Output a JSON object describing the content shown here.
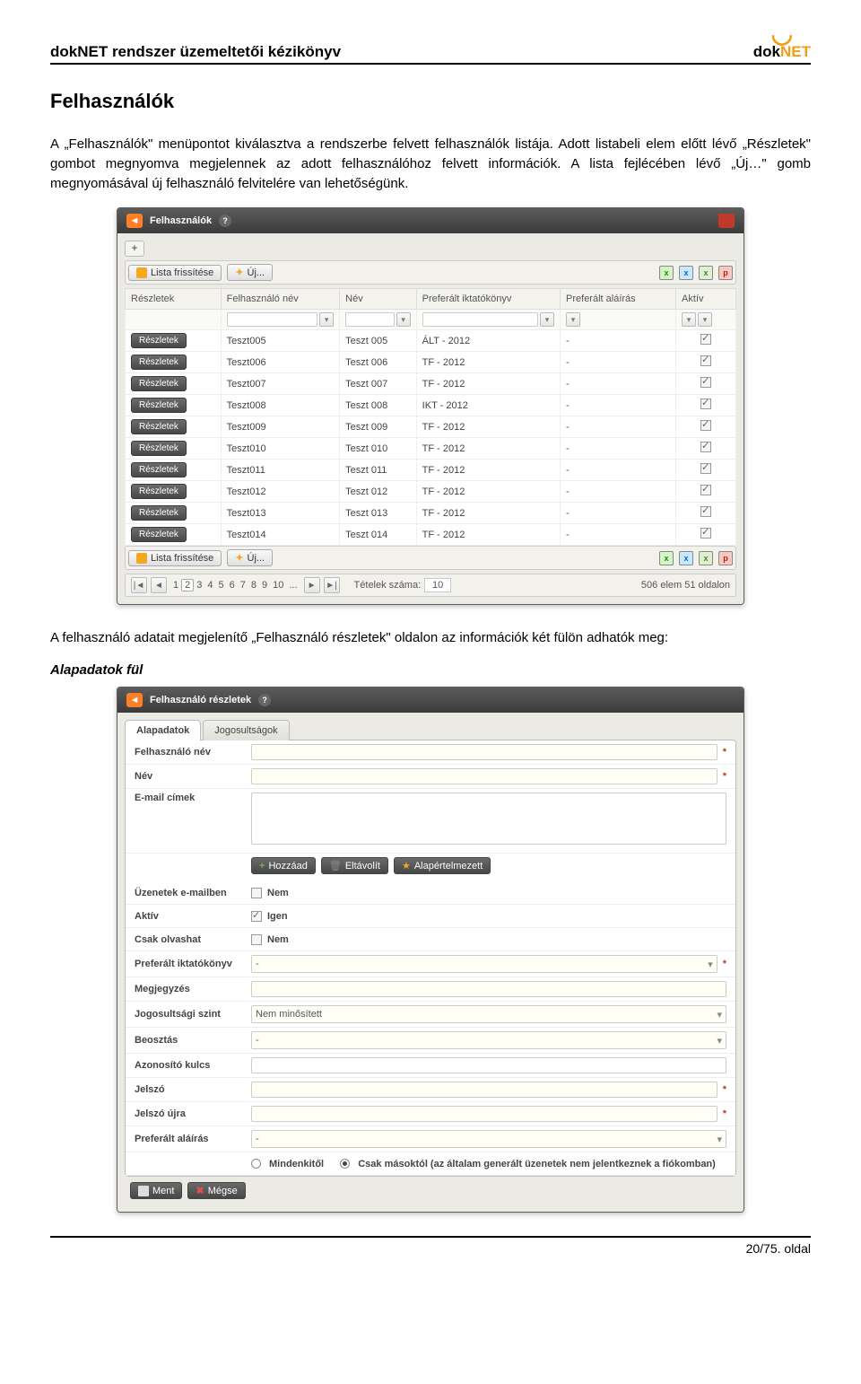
{
  "doc": {
    "header_title": "dokNET rendszer üzemeltetői kézikönyv",
    "logo_brand_left": "dok",
    "logo_brand_right": "NET",
    "section_title": "Felhasználók",
    "para1": "A „Felhasználók\" menüpontot kiválasztva a rendszerbe felvett felhasználók listája. Adott listabeli elem előtt lévő „Részletek\" gombot megnyomva megjelennek az adott felhasználóhoz felvett információk. A lista fejlécében lévő „Új…\" gomb megnyomásával új felhasználó felvitelére van lehetőségünk.",
    "para2": "A felhasználó adatait megjelenítő „Felhasználó részletek\" oldalon az információk két fülön adhatók meg:",
    "sub_alap": "Alapadatok fül",
    "page_number": "20/75. oldal"
  },
  "list": {
    "title": "Felhasználók",
    "refresh": "Lista frissítése",
    "new_btn": "Új...",
    "cols": {
      "details": "Részletek",
      "username": "Felhasználó név",
      "name": "Név",
      "book": "Preferált iktatókönyv",
      "sign": "Preferált aláírás",
      "active": "Aktív"
    },
    "rows": [
      {
        "btn": "Részletek",
        "u": "Teszt005",
        "n": "Teszt 005",
        "b": "ÁLT - 2012",
        "s": "-",
        "a": true
      },
      {
        "btn": "Részletek",
        "u": "Teszt006",
        "n": "Teszt 006",
        "b": "TF - 2012",
        "s": "-",
        "a": true
      },
      {
        "btn": "Részletek",
        "u": "Teszt007",
        "n": "Teszt 007",
        "b": "TF - 2012",
        "s": "-",
        "a": true
      },
      {
        "btn": "Részletek",
        "u": "Teszt008",
        "n": "Teszt 008",
        "b": "IKT - 2012",
        "s": "-",
        "a": true
      },
      {
        "btn": "Részletek",
        "u": "Teszt009",
        "n": "Teszt 009",
        "b": "TF - 2012",
        "s": "-",
        "a": true
      },
      {
        "btn": "Részletek",
        "u": "Teszt010",
        "n": "Teszt 010",
        "b": "TF - 2012",
        "s": "-",
        "a": true
      },
      {
        "btn": "Részletek",
        "u": "Teszt011",
        "n": "Teszt 011",
        "b": "TF - 2012",
        "s": "-",
        "a": true
      },
      {
        "btn": "Részletek",
        "u": "Teszt012",
        "n": "Teszt 012",
        "b": "TF - 2012",
        "s": "-",
        "a": true
      },
      {
        "btn": "Részletek",
        "u": "Teszt013",
        "n": "Teszt 013",
        "b": "TF - 2012",
        "s": "-",
        "a": true
      },
      {
        "btn": "Részletek",
        "u": "Teszt014",
        "n": "Teszt 014",
        "b": "TF - 2012",
        "s": "-",
        "a": true
      }
    ],
    "pager": {
      "pages": [
        "1",
        "2",
        "3",
        "4",
        "5",
        "6",
        "7",
        "8",
        "9",
        "10",
        "..."
      ],
      "current": "2",
      "items_label": "Tételek száma:",
      "items_value": "10",
      "summary": "506 elem 51 oldalon"
    }
  },
  "details": {
    "title": "Felhasználó részletek",
    "tabs": {
      "alap": "Alapadatok",
      "jog": "Jogosultságok"
    },
    "labels": {
      "username": "Felhasználó név",
      "name": "Név",
      "emails": "E-mail címek",
      "add": "Hozzáad",
      "remove": "Eltávolít",
      "default": "Alapértelmezett",
      "msg_email": "Üzenetek e-mailben",
      "no": "Nem",
      "active": "Aktív",
      "yes": "Igen",
      "readonly": "Csak olvashat",
      "book": "Preferált iktatókönyv",
      "note": "Megjegyzés",
      "level": "Jogosultsági szint",
      "level_val": "Nem minősített",
      "position": "Beosztás",
      "key": "Azonosító kulcs",
      "pass": "Jelszó",
      "pass2": "Jelszó újra",
      "sign": "Preferált aláírás",
      "radio_all": "Mindenkitől",
      "radio_others": "Csak másoktól (az általam generált üzenetek nem jelentkeznek a fiókomban)",
      "save": "Ment",
      "cancel": "Mégse"
    }
  }
}
